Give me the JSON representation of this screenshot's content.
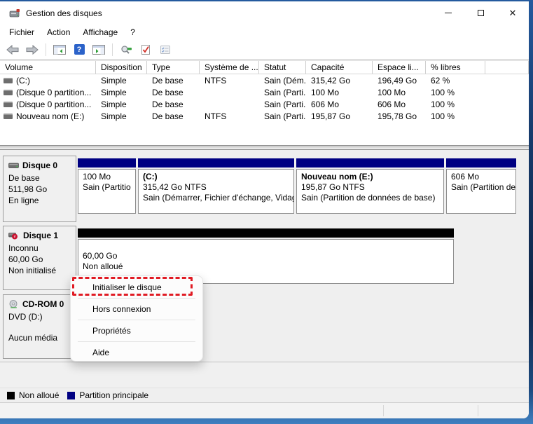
{
  "window": {
    "title": "Gestion des disques"
  },
  "menu_bar": {
    "items": [
      "Fichier",
      "Action",
      "Affichage",
      "?"
    ]
  },
  "toolbar": {
    "icons": [
      "back-icon",
      "forward-icon",
      "console-tree-icon",
      "help-icon",
      "action-pane-icon",
      "rescan-disks-icon",
      "check-document-icon",
      "settings-list-icon"
    ]
  },
  "volume_table": {
    "columns": [
      "Volume",
      "Disposition",
      "Type",
      "Système de ...",
      "Statut",
      "Capacité",
      "Espace li...",
      "% libres"
    ],
    "rows": [
      {
        "volume": "(C:)",
        "disposition": "Simple",
        "type": "De base",
        "systeme": "NTFS",
        "statut": "Sain (Dém...",
        "capacite": "315,42 Go",
        "espace": "196,49 Go",
        "libres": "62 %"
      },
      {
        "volume": "(Disque 0 partition...",
        "disposition": "Simple",
        "type": "De base",
        "systeme": "",
        "statut": "Sain (Parti...",
        "capacite": "100 Mo",
        "espace": "100 Mo",
        "libres": "100 %"
      },
      {
        "volume": "(Disque 0 partition...",
        "disposition": "Simple",
        "type": "De base",
        "systeme": "",
        "statut": "Sain (Parti...",
        "capacite": "606 Mo",
        "espace": "606 Mo",
        "libres": "100 %"
      },
      {
        "volume": "Nouveau nom (E:)",
        "disposition": "Simple",
        "type": "De base",
        "systeme": "NTFS",
        "statut": "Sain (Parti...",
        "capacite": "195,87 Go",
        "espace": "195,78 Go",
        "libres": "100 %"
      }
    ]
  },
  "disks": [
    {
      "name": "Disque 0",
      "line1": "De base",
      "line2": "511,98 Go",
      "line3": "En ligne",
      "partitions": [
        {
          "title": "",
          "line1": "100 Mo",
          "line2": "Sain (Partitio"
        },
        {
          "title": "(C:)",
          "line1": "315,42 Go NTFS",
          "line2": "Sain (Démarrer, Fichier d'échange, Vidag"
        },
        {
          "title": "Nouveau nom  (E:)",
          "line1": "195,87 Go NTFS",
          "line2": "Sain (Partition de données de base)"
        },
        {
          "title": "",
          "line1": "606 Mo",
          "line2": "Sain (Partition de ré"
        }
      ]
    },
    {
      "name": "Disque 1",
      "line1": "Inconnu",
      "line2": "60,00 Go",
      "line3": "Non initialisé",
      "partitions": [
        {
          "title": "",
          "line1": "60,00 Go",
          "line2": "Non alloué"
        }
      ]
    },
    {
      "name": "CD-ROM 0",
      "line1": "DVD (D:)",
      "line2": "",
      "line3": "Aucun média",
      "partitions": []
    }
  ],
  "context_menu": {
    "items": [
      "Initialiser le disque",
      "Hors connexion",
      "Propriétés",
      "Aide"
    ]
  },
  "legend": {
    "items": [
      {
        "label": "Non alloué",
        "color": "#000000"
      },
      {
        "label": "Partition principale",
        "color": "#000082"
      }
    ]
  },
  "colors": {
    "partition_primary": "#000082",
    "unallocated": "#000000",
    "annotation_red": "#e01b24"
  }
}
